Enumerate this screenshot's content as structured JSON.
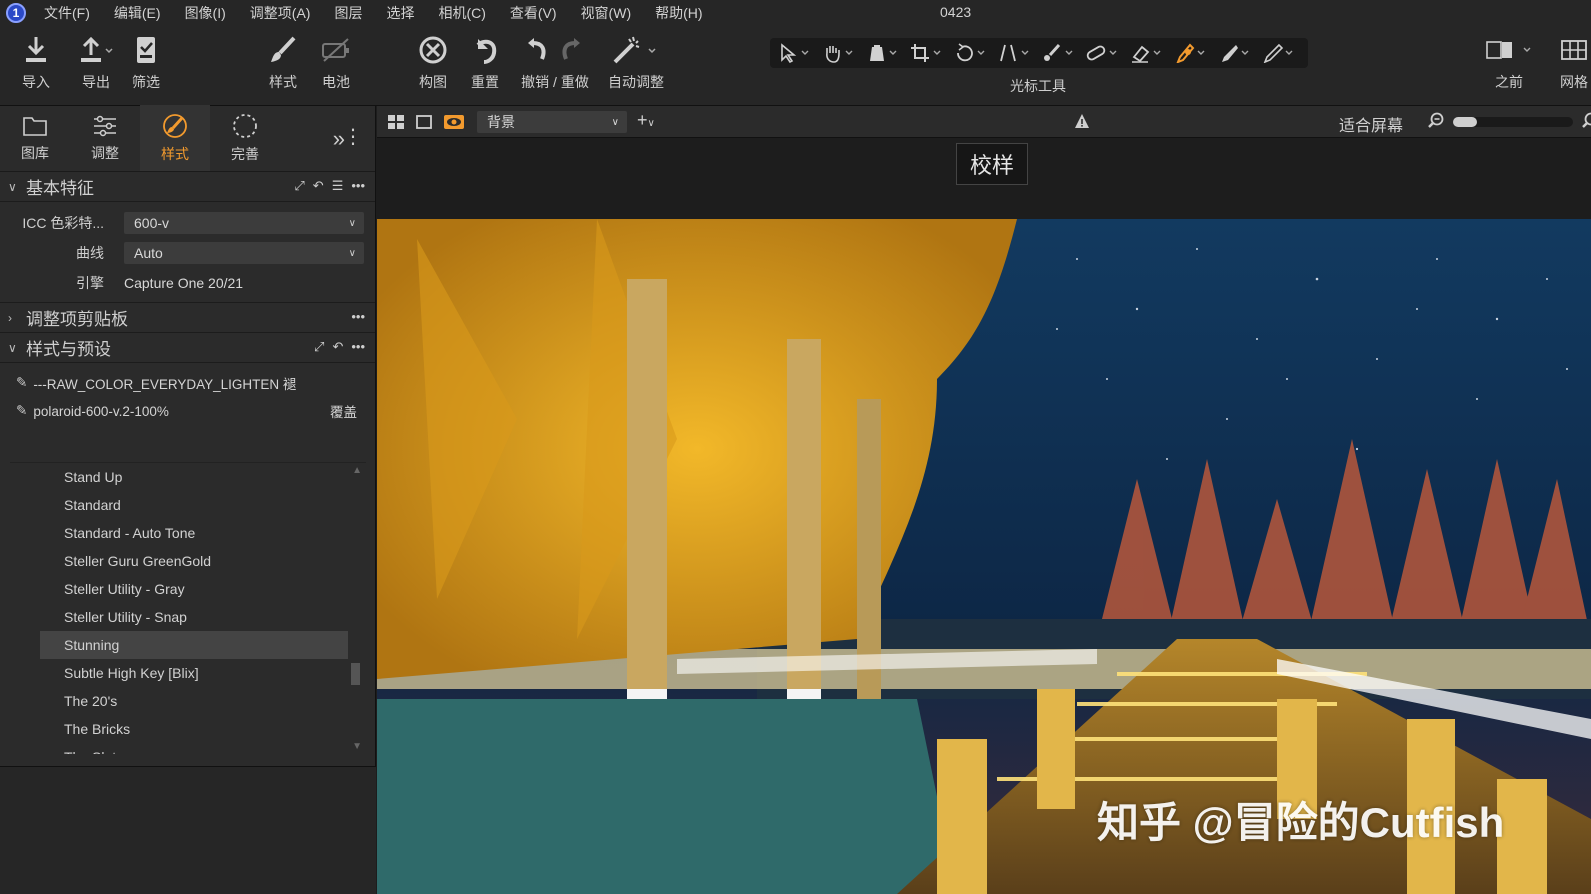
{
  "app": {
    "icon_letter": "1",
    "window_title": "0423"
  },
  "menu": [
    "文件(F)",
    "编辑(E)",
    "图像(I)",
    "调整项(A)",
    "图层",
    "选择",
    "相机(C)",
    "查看(V)",
    "视窗(W)",
    "帮助(H)"
  ],
  "toolbar": {
    "import": "导入",
    "export": "导出",
    "filter": "筛选",
    "style": "样式",
    "battery": "电池",
    "compose": "构图",
    "reset": "重置",
    "undo_redo": "撤销 / 重做",
    "auto_adjust": "自动调整",
    "cursor_tools": "光标工具",
    "before": "之前",
    "grid": "网格"
  },
  "tool_tabs": [
    {
      "label": "图库",
      "icon": "folder-icon"
    },
    {
      "label": "调整",
      "icon": "sliders-icon"
    },
    {
      "label": "样式",
      "icon": "style-icon",
      "active": true
    },
    {
      "label": "完善",
      "icon": "refine-icon"
    }
  ],
  "basic": {
    "title": "基本特征",
    "icc_label": "ICC 色彩特...",
    "icc_value": "600-v",
    "curve_label": "曲线",
    "curve_value": "Auto",
    "engine_label": "引擎",
    "engine_value": "Capture One 20/21"
  },
  "clipboard": {
    "title": "调整项剪贴板"
  },
  "styles": {
    "title": "样式与预设",
    "applied": [
      {
        "name": "---RAW_COLOR_EVERYDAY_LIGHTEN 褪",
        "right": ""
      },
      {
        "name": "polaroid-600-v.2-100%",
        "right": "覆盖"
      }
    ],
    "list": [
      "Stand Up",
      "Standard",
      "Standard - Auto Tone",
      "Steller Guru GreenGold",
      "Steller Utility - Gray",
      "Steller Utility - Snap",
      "Stunning",
      "Subtle High Key [Blix]",
      "The 20's",
      "The Bricks",
      "The Slats"
    ],
    "selected": "Stunning"
  },
  "viewer": {
    "background_label": "背景",
    "fit_label": "适合屏幕",
    "zoom_fraction": 0.2,
    "proof_label": "校样",
    "watermark": "知乎 @冒险的Cutfish"
  },
  "colors": {
    "accent": "#f29a2e",
    "panel": "#2b2b2b",
    "sky": "#0f2a4a",
    "foliage": "#e0a51c"
  }
}
